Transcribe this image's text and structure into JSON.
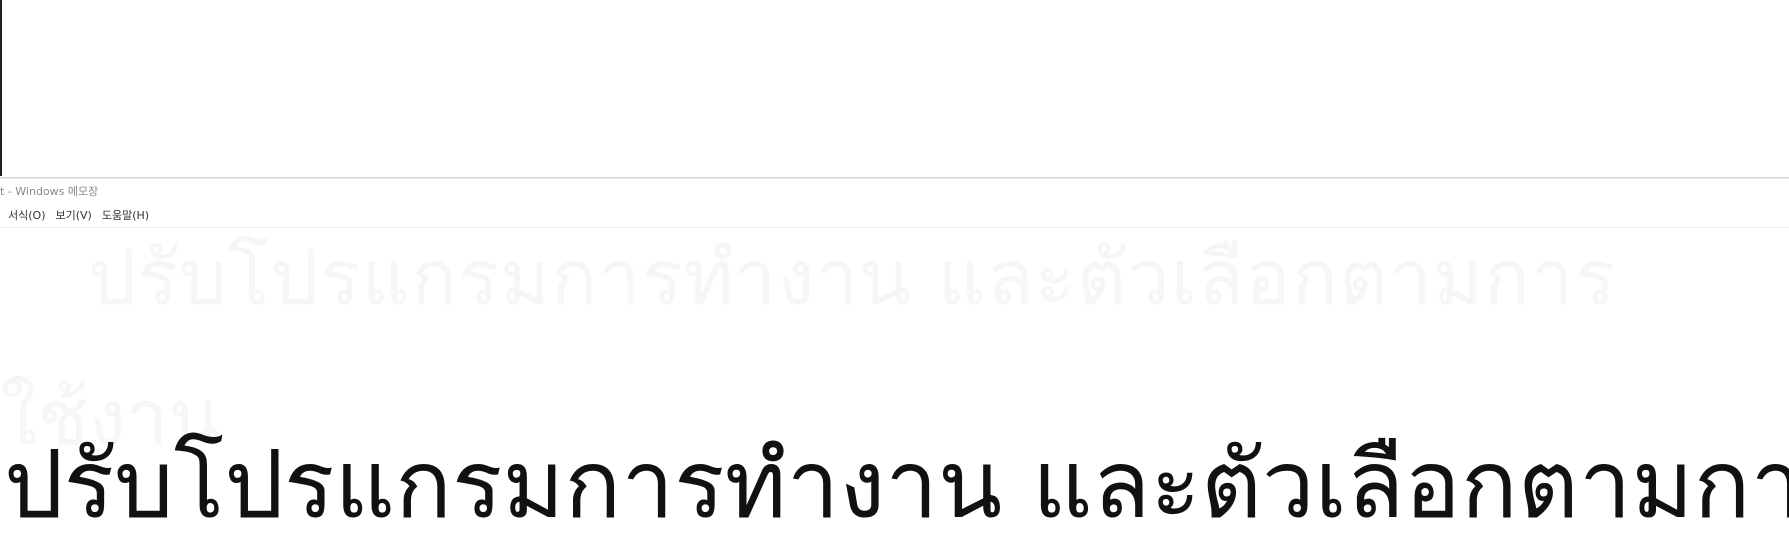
{
  "window": {
    "title": "t - Windows 메모장"
  },
  "menu": {
    "items": [
      {
        "label": "서식(O)"
      },
      {
        "label": "보기(V)"
      },
      {
        "label": "도움말(H)"
      }
    ]
  },
  "editor": {
    "ghost_line_1": "ปรับโปรแกรมการทำงาน และตัวเลือกตามการ",
    "ghost_line_2": "ใช้งาน",
    "text": "ปรับโปรแกรมการทำงาน และตัวเลือกตามการใช้งาน"
  }
}
